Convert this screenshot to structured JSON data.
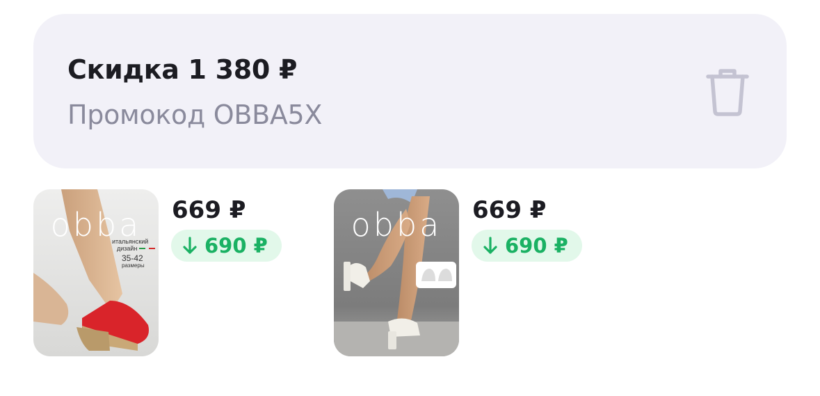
{
  "promo": {
    "title": "Скидка 1 380 ₽",
    "code": "Промокод OBBA5X"
  },
  "products": [
    {
      "brand": "obba",
      "tag_line1": "итальянский",
      "tag_line2": "дизайн",
      "sizes": "35-42",
      "sizes_label": "размеры",
      "price": "669 ₽",
      "old_price": "690 ₽"
    },
    {
      "brand": "obba",
      "price": "669 ₽",
      "old_price": "690 ₽"
    }
  ],
  "icons": {
    "delete": "trash-icon",
    "discount_arrow": "arrow-down-icon"
  },
  "colors": {
    "card_bg": "#f2f1f8",
    "discount_green": "#1ab163",
    "discount_bg": "#e2f8ea"
  }
}
